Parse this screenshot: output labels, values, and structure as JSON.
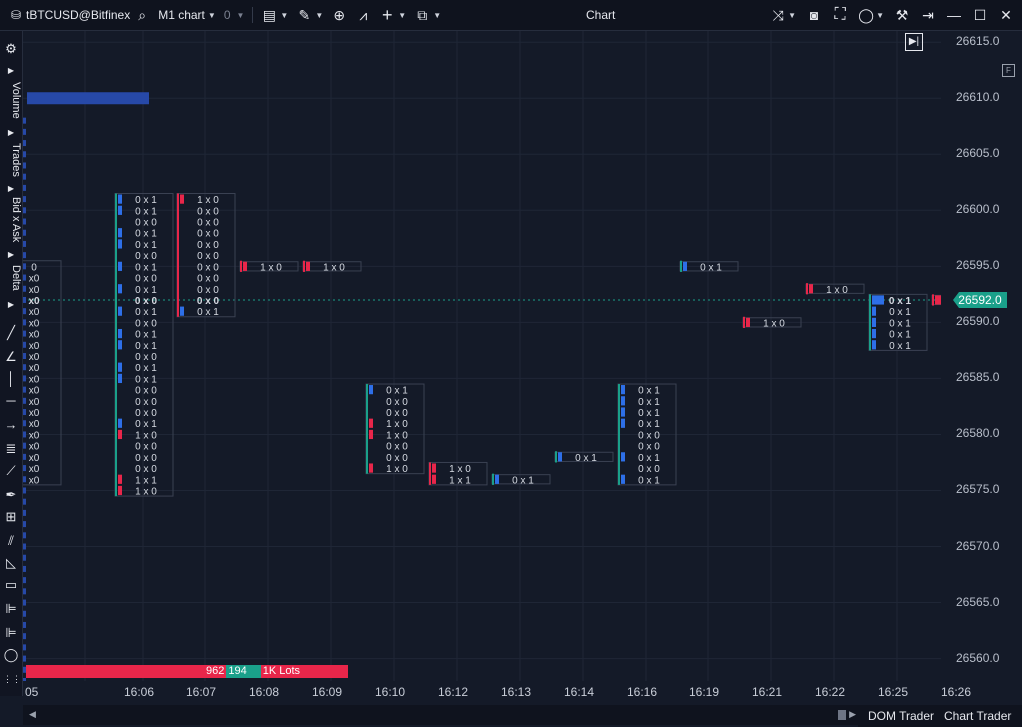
{
  "titlebar": {
    "symbol": "tBTCUSD@Bitfinex",
    "timeframe": "M1 chart",
    "count": "0",
    "window_title": "Chart"
  },
  "left_tabs": [
    "Volume",
    "Trades",
    "Bid x Ask",
    "Delta"
  ],
  "price_axis": {
    "labels": [
      "26615.0",
      "26610.0",
      "26605.0",
      "26600.0",
      "26595.0",
      "26590.0",
      "26585.0",
      "26580.0",
      "26575.0",
      "26570.0",
      "26565.0",
      "26560.0"
    ],
    "current": "26592.0"
  },
  "time_axis": {
    "labels": [
      "05",
      "16:06",
      "16:07",
      "16:08",
      "16:09",
      "16:10",
      "16:12",
      "16:13",
      "16:14",
      "16:16",
      "16:19",
      "16:21",
      "16:22",
      "16:25",
      "16:26"
    ]
  },
  "volume_footer": {
    "sell": "962",
    "buy": "194",
    "lots": "1K Lots"
  },
  "bottom_tabs": [
    "DOM Trader",
    "Chart Trader"
  ],
  "colors": {
    "bg": "#141a28",
    "sell": "#e8264a",
    "buy": "#2e6fe8",
    "delta_pos": "#1aa08a",
    "grid": "#1f2636"
  },
  "chart_data": {
    "type": "footprint",
    "ylim": [
      26558.0,
      26616.0
    ],
    "price_step": 1.0,
    "current_price": 26592.0,
    "columns": [
      {
        "time": "16:05",
        "cells": [
          {
            "p": 26595,
            "t": "0"
          },
          {
            "p": 26594,
            "t": "x0"
          },
          {
            "p": 26593,
            "t": "x0"
          },
          {
            "p": 26592,
            "t": "x0"
          },
          {
            "p": 26591,
            "t": "x0"
          },
          {
            "p": 26590,
            "t": "x0"
          },
          {
            "p": 26589,
            "t": "x0"
          },
          {
            "p": 26588,
            "t": "x0"
          },
          {
            "p": 26587,
            "t": "x0"
          },
          {
            "p": 26586,
            "t": "x0"
          },
          {
            "p": 26585,
            "t": "x0"
          },
          {
            "p": 26584,
            "t": "x0"
          },
          {
            "p": 26583,
            "t": "x0"
          },
          {
            "p": 26582,
            "t": "x0"
          },
          {
            "p": 26581,
            "t": "x0"
          },
          {
            "p": 26580,
            "t": "x0"
          },
          {
            "p": 26579,
            "t": "x0"
          },
          {
            "p": 26578,
            "t": "x0"
          },
          {
            "p": 26577,
            "t": "x0"
          },
          {
            "p": 26576,
            "t": "x0"
          }
        ]
      },
      {
        "time": "16:06",
        "cells": [
          {
            "p": 26601,
            "t": "0 x 1"
          },
          {
            "p": 26600,
            "t": "0 x 1"
          },
          {
            "p": 26599,
            "t": "0 x 0"
          },
          {
            "p": 26598,
            "t": "0 x 1"
          },
          {
            "p": 26597,
            "t": "0 x 1"
          },
          {
            "p": 26596,
            "t": "0 x 0"
          },
          {
            "p": 26595,
            "t": "0 x 1"
          },
          {
            "p": 26594,
            "t": "0 x 0"
          },
          {
            "p": 26593,
            "t": "0 x 1"
          },
          {
            "p": 26592,
            "t": "0 x 0"
          },
          {
            "p": 26591,
            "t": "0 x 1"
          },
          {
            "p": 26590,
            "t": "0 x 0"
          },
          {
            "p": 26589,
            "t": "0 x 1"
          },
          {
            "p": 26588,
            "t": "0 x 1"
          },
          {
            "p": 26587,
            "t": "0 x 0"
          },
          {
            "p": 26586,
            "t": "0 x 1"
          },
          {
            "p": 26585,
            "t": "0 x 1"
          },
          {
            "p": 26584,
            "t": "0 x 0"
          },
          {
            "p": 26583,
            "t": "0 x 0"
          },
          {
            "p": 26582,
            "t": "0 x 0"
          },
          {
            "p": 26581,
            "t": "0 x 1"
          },
          {
            "p": 26580,
            "t": "1 x 0"
          },
          {
            "p": 26579,
            "t": "0 x 0"
          },
          {
            "p": 26578,
            "t": "0 x 0"
          },
          {
            "p": 26577,
            "t": "0 x 0"
          },
          {
            "p": 26576,
            "t": "1 x 1"
          },
          {
            "p": 26575,
            "t": "1 x 0"
          }
        ]
      },
      {
        "time": "16:07",
        "cells": [
          {
            "p": 26601,
            "t": "1 x 0"
          },
          {
            "p": 26600,
            "t": "0 x 0"
          },
          {
            "p": 26599,
            "t": "0 x 0"
          },
          {
            "p": 26598,
            "t": "0 x 0"
          },
          {
            "p": 26597,
            "t": "0 x 0"
          },
          {
            "p": 26596,
            "t": "0 x 0"
          },
          {
            "p": 26595,
            "t": "0 x 0"
          },
          {
            "p": 26594,
            "t": "0 x 0"
          },
          {
            "p": 26593,
            "t": "0 x 0"
          },
          {
            "p": 26592,
            "t": "0 x 0"
          },
          {
            "p": 26591,
            "t": "0 x 1"
          }
        ]
      },
      {
        "time": "16:08",
        "cells": [
          {
            "p": 26595,
            "t": "1 x 0"
          }
        ]
      },
      {
        "time": "16:09",
        "cells": [
          {
            "p": 26595,
            "t": "1 x 0"
          }
        ]
      },
      {
        "time": "16:10",
        "cells": [
          {
            "p": 26584,
            "t": "0 x 1"
          },
          {
            "p": 26583,
            "t": "0 x 0"
          },
          {
            "p": 26582,
            "t": "0 x 0"
          },
          {
            "p": 26581,
            "t": "1 x 0"
          },
          {
            "p": 26580,
            "t": "1 x 0"
          },
          {
            "p": 26579,
            "t": "0 x 0"
          },
          {
            "p": 26578,
            "t": "0 x 0"
          },
          {
            "p": 26577,
            "t": "1 x 0"
          }
        ]
      },
      {
        "time": "16:12",
        "cells": [
          {
            "p": 26577,
            "t": "1 x 0"
          },
          {
            "p": 26576,
            "t": "1 x 1"
          }
        ]
      },
      {
        "time": "16:13",
        "cells": [
          {
            "p": 26576,
            "t": "0 x 1"
          }
        ]
      },
      {
        "time": "16:14",
        "cells": [
          {
            "p": 26578,
            "t": "0 x 1"
          }
        ]
      },
      {
        "time": "16:16",
        "cells": [
          {
            "p": 26584,
            "t": "0 x 1"
          },
          {
            "p": 26583,
            "t": "0 x 1"
          },
          {
            "p": 26582,
            "t": "0 x 1"
          },
          {
            "p": 26581,
            "t": "0 x 1"
          },
          {
            "p": 26580,
            "t": "0 x 0"
          },
          {
            "p": 26579,
            "t": "0 x 0"
          },
          {
            "p": 26578,
            "t": "0 x 1"
          },
          {
            "p": 26577,
            "t": "0 x 0"
          },
          {
            "p": 26576,
            "t": "0 x 1"
          }
        ]
      },
      {
        "time": "16:19",
        "cells": [
          {
            "p": 26595,
            "t": "0 x 1"
          }
        ]
      },
      {
        "time": "16:21",
        "cells": [
          {
            "p": 26590,
            "t": "1 x 0"
          }
        ]
      },
      {
        "time": "16:22",
        "cells": [
          {
            "p": 26593,
            "t": "1 x 0"
          }
        ]
      },
      {
        "time": "16:25",
        "cells": [
          {
            "p": 26592,
            "t": "0 x 1"
          },
          {
            "p": 26591,
            "t": "0 x 1"
          },
          {
            "p": 26590,
            "t": "0 x 1"
          },
          {
            "p": 26589,
            "t": "0 x 1"
          },
          {
            "p": 26588,
            "t": "0 x 1"
          }
        ]
      },
      {
        "time": "16:26",
        "cells": [
          {
            "p": 26592,
            "t": "1 x 0"
          }
        ]
      }
    ]
  }
}
